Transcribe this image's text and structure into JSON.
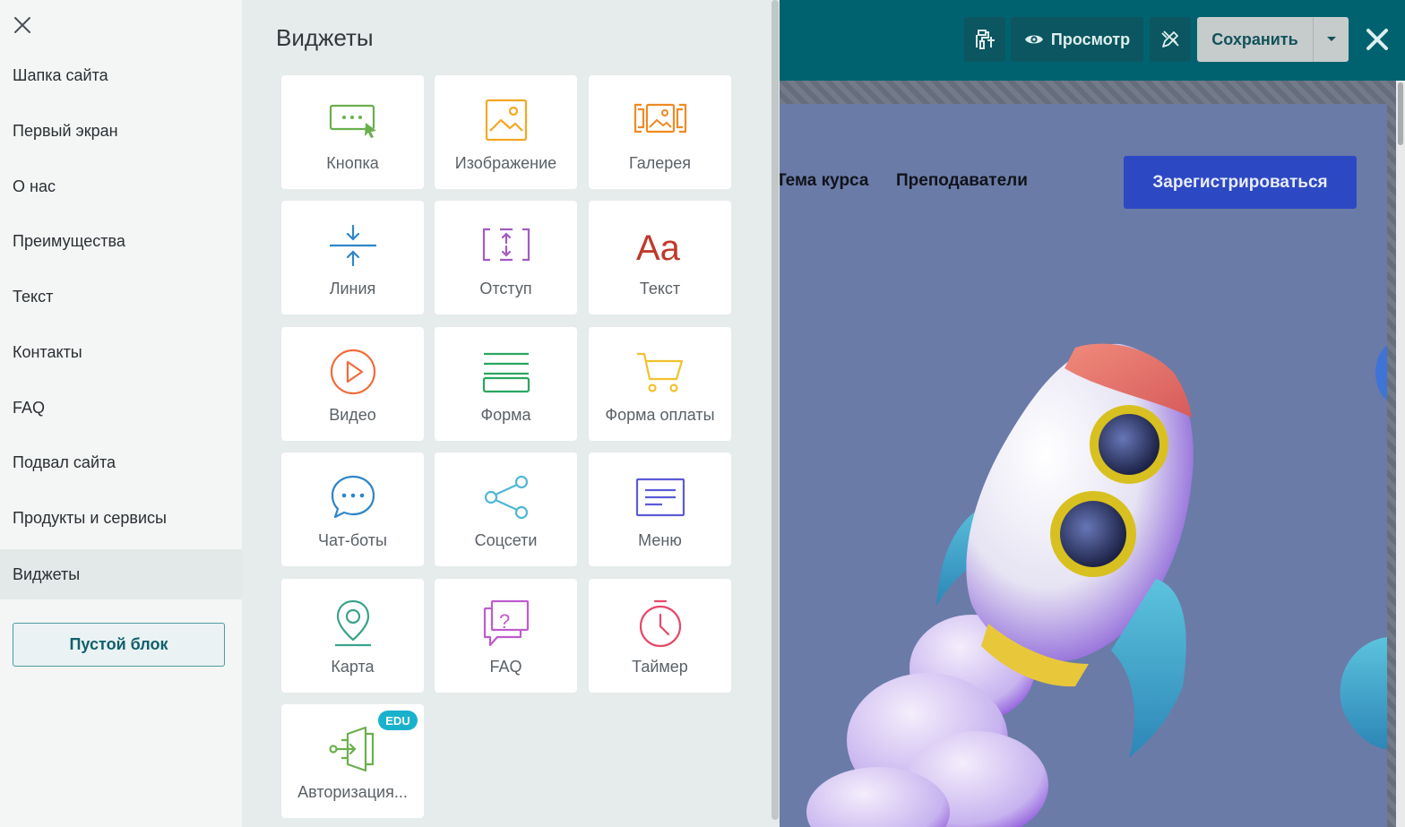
{
  "sidebar": {
    "items": [
      {
        "label": "Шапка сайта"
      },
      {
        "label": "Первый экран"
      },
      {
        "label": "О нас"
      },
      {
        "label": "Преимущества"
      },
      {
        "label": "Текст"
      },
      {
        "label": "Контакты"
      },
      {
        "label": "FAQ"
      },
      {
        "label": "Подвал сайта"
      },
      {
        "label": "Продукты и сервисы"
      },
      {
        "label": "Виджеты",
        "active": true
      }
    ],
    "empty_block_label": "Пустой блок"
  },
  "widgets": {
    "title": "Виджеты",
    "tiles": [
      {
        "label": "Кнопка",
        "icon": "button-widget-icon",
        "color": "#6ab04c"
      },
      {
        "label": "Изображение",
        "icon": "image-icon",
        "color": "#f5a623"
      },
      {
        "label": "Галерея",
        "icon": "gallery-icon",
        "color": "#f08a24"
      },
      {
        "label": "Линия",
        "icon": "line-icon",
        "color": "#2f86c8"
      },
      {
        "label": "Отступ",
        "icon": "spacing-icon",
        "color": "#a45ac0"
      },
      {
        "label": "Текст",
        "icon": "text-icon",
        "color": "#c0392b"
      },
      {
        "label": "Видео",
        "icon": "video-play-icon",
        "color": "#f26b3a"
      },
      {
        "label": "Форма",
        "icon": "form-icon",
        "color": "#2aa660"
      },
      {
        "label": "Форма оплаты",
        "icon": "cart-icon",
        "color": "#f2c12e"
      },
      {
        "label": "Чат-боты",
        "icon": "chat-bubble-icon",
        "color": "#2f86c8"
      },
      {
        "label": "Соцсети",
        "icon": "share-icon",
        "color": "#4fb7d6"
      },
      {
        "label": "Меню",
        "icon": "menu-icon",
        "color": "#5b5bd6"
      },
      {
        "label": "Карта",
        "icon": "map-pin-icon",
        "color": "#3aa38a"
      },
      {
        "label": "FAQ",
        "icon": "faq-icon",
        "color": "#c05ccd"
      },
      {
        "label": "Таймер",
        "icon": "timer-icon",
        "color": "#e64a6b"
      },
      {
        "label": "Авторизация...",
        "icon": "login-icon",
        "color": "#6ab04c",
        "badge": "EDU"
      }
    ]
  },
  "topbar": {
    "preview_label": "Просмотр",
    "save_label": "Сохранить"
  },
  "site_preview": {
    "nav_links": [
      "Тема курса",
      "Преподаватели"
    ],
    "register_label": "Зарегистрироваться"
  },
  "colors": {
    "topbar_bg": "#00626f",
    "accent_teal": "#11606c",
    "register_bg": "#2d48c3",
    "site_bg": "#6a7ba8"
  }
}
